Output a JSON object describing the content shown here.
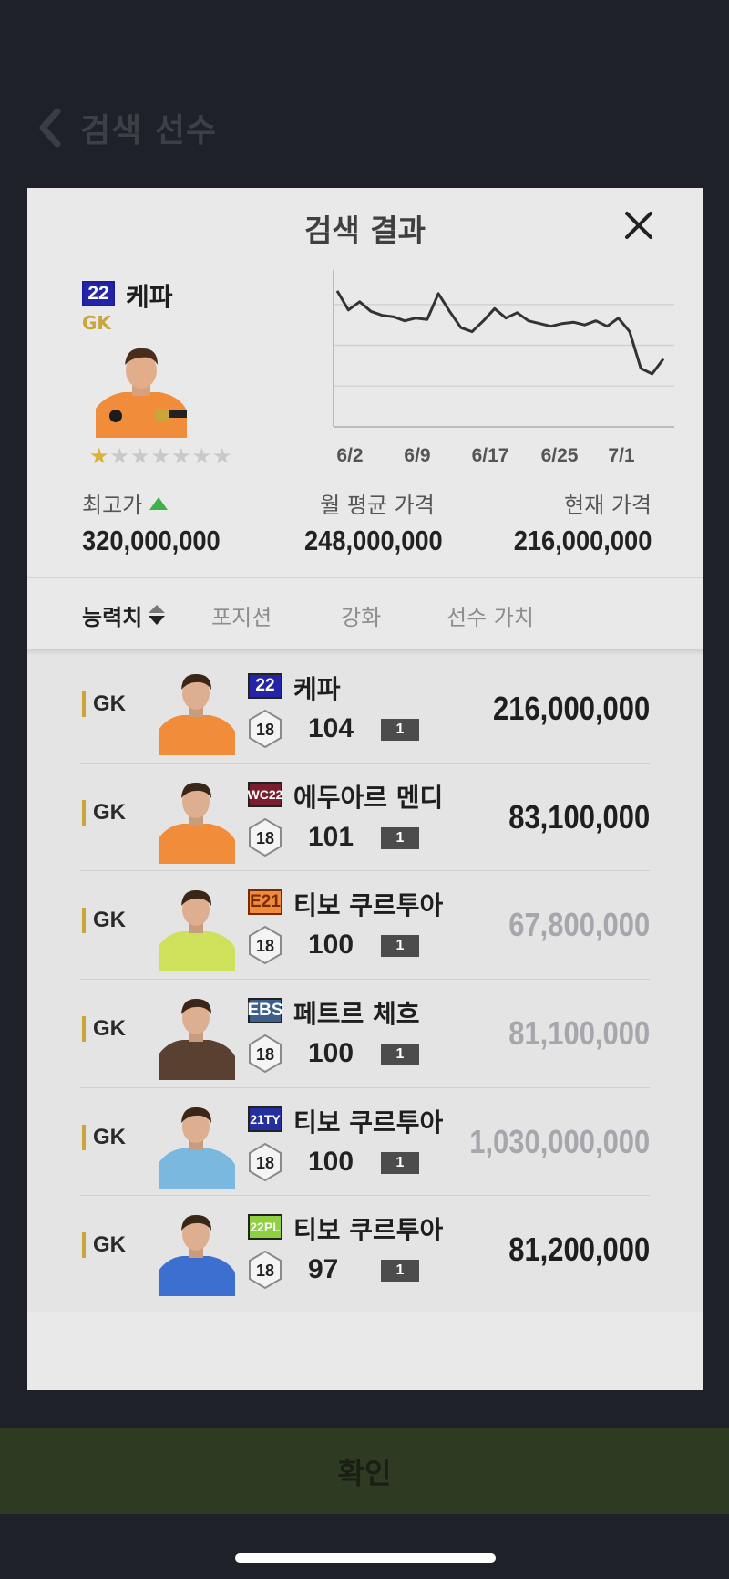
{
  "page": {
    "title": "검색 선수",
    "confirm_label": "확인"
  },
  "modal": {
    "title": "검색 결과",
    "player": {
      "season": "22",
      "name": "케파",
      "position": "GK",
      "stars": {
        "filled": 1,
        "total": 7
      }
    },
    "chart_data": {
      "type": "line",
      "x_tick_labels": [
        "6/2",
        "6/9",
        "6/17",
        "6/25",
        "7/1"
      ],
      "values": [
        100,
        86,
        92,
        85,
        82,
        81,
        78,
        80,
        79,
        98,
        85,
        73,
        70,
        78,
        87,
        80,
        84,
        78,
        76,
        74,
        76,
        77,
        75,
        78,
        74,
        80,
        70,
        43,
        39,
        50
      ],
      "ylim": [
        0,
        110
      ],
      "grid": true,
      "color": "#333333"
    },
    "prices": {
      "high_label": "최고가",
      "high_value": "320,000,000",
      "avg_label": "월 평균 가격",
      "avg_value": "248,000,000",
      "current_label": "현재 가격",
      "current_value": "216,000,000"
    },
    "tabs": [
      "능력치",
      "포지션",
      "강화",
      "선수 가치"
    ],
    "results": [
      {
        "position": "GK",
        "season": "22",
        "season_bg": "#2424a8",
        "season_fg": "#ffffff",
        "name": "케파",
        "grade": "18",
        "ovr": "104",
        "enhance": "1",
        "price": "216,000,000",
        "price_dim": false,
        "kit": "#f08c3a"
      },
      {
        "position": "GK",
        "season": "WC22",
        "season_bg": "#7a1d2e",
        "season_fg": "#ffffff",
        "name": "에두아르 멘디",
        "grade": "18",
        "ovr": "101",
        "enhance": "1",
        "price": "83,100,000",
        "price_dim": false,
        "kit": "#f08c3a"
      },
      {
        "position": "GK",
        "season": "E21",
        "season_bg": "#f08a3c",
        "season_fg": "#7a2a00",
        "name": "티보 쿠르투아",
        "grade": "18",
        "ovr": "100",
        "enhance": "1",
        "price": "67,800,000",
        "price_dim": true,
        "kit": "#cfe05a"
      },
      {
        "position": "GK",
        "season": "EBS",
        "season_bg": "#3d5f8a",
        "season_fg": "#ffffff",
        "name": "페트르 체흐",
        "grade": "18",
        "ovr": "100",
        "enhance": "1",
        "price": "81,100,000",
        "price_dim": true,
        "kit": "#5a4030"
      },
      {
        "position": "GK",
        "season": "21TY",
        "season_bg": "#2430a0",
        "season_fg": "#ffffff",
        "name": "티보 쿠르투아",
        "grade": "18",
        "ovr": "100",
        "enhance": "1",
        "price": "1,030,000,000",
        "price_dim": true,
        "kit": "#7ab8e0"
      },
      {
        "position": "GK",
        "season": "22PL",
        "season_bg": "#8fd040",
        "season_fg": "#ffffff",
        "name": "티보 쿠르투아",
        "grade": "18",
        "ovr": "97",
        "enhance": "1",
        "price": "81,200,000",
        "price_dim": false,
        "kit": "#3d6fd0"
      }
    ]
  }
}
